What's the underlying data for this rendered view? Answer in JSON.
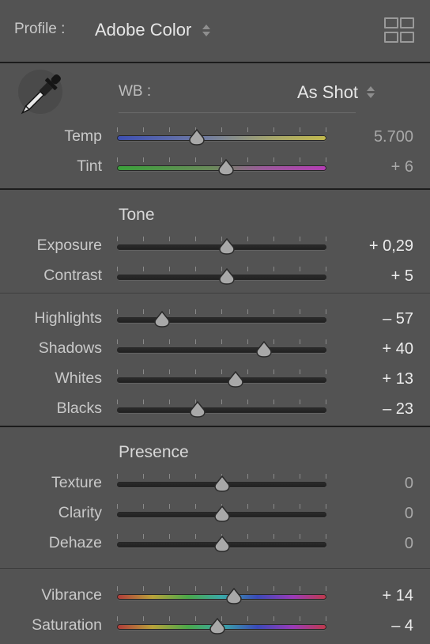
{
  "profile": {
    "label": "Profile :",
    "value": "Adobe Color"
  },
  "icons": {
    "grid": "grid-view-icon",
    "eyedropper": "white-balance-selector-icon",
    "updown": "up-down-arrows-icon"
  },
  "wb": {
    "label": "WB :",
    "value": "As Shot"
  },
  "sliders": [
    {
      "id": "temp",
      "label": "Temp",
      "value": "5.700",
      "level": 0.38,
      "dim": true
    },
    {
      "id": "tint",
      "label": "Tint",
      "value": "+ 6",
      "level": 0.52,
      "dim": true
    },
    {
      "id": "exposure",
      "label": "Exposure",
      "value": "+ 0,29",
      "level": 0.526
    },
    {
      "id": "contrast",
      "label": "Contrast",
      "value": "+ 5",
      "level": 0.525
    },
    {
      "id": "highlights",
      "label": "Highlights",
      "value": "– 57",
      "level": 0.215
    },
    {
      "id": "shadows",
      "label": "Shadows",
      "value": "+ 40",
      "level": 0.7
    },
    {
      "id": "whites",
      "label": "Whites",
      "value": "+ 13",
      "level": 0.565
    },
    {
      "id": "blacks",
      "label": "Blacks",
      "value": "– 23",
      "level": 0.385
    },
    {
      "id": "texture",
      "label": "Texture",
      "value": "0",
      "level": 0.5,
      "dim": true
    },
    {
      "id": "clarity",
      "label": "Clarity",
      "value": "0",
      "level": 0.5,
      "dim": true
    },
    {
      "id": "dehaze",
      "label": "Dehaze",
      "value": "0",
      "level": 0.5,
      "dim": true
    },
    {
      "id": "vibrance",
      "label": "Vibrance",
      "value": "+ 14",
      "level": 0.56
    },
    {
      "id": "saturation",
      "label": "Saturation",
      "value": "– 4",
      "level": 0.48
    }
  ],
  "sections": {
    "tone": "Tone",
    "presence": "Presence"
  },
  "colors": {
    "background": "#535353",
    "thumb": "#a8a8a8",
    "divider": "#1c1c1c"
  }
}
